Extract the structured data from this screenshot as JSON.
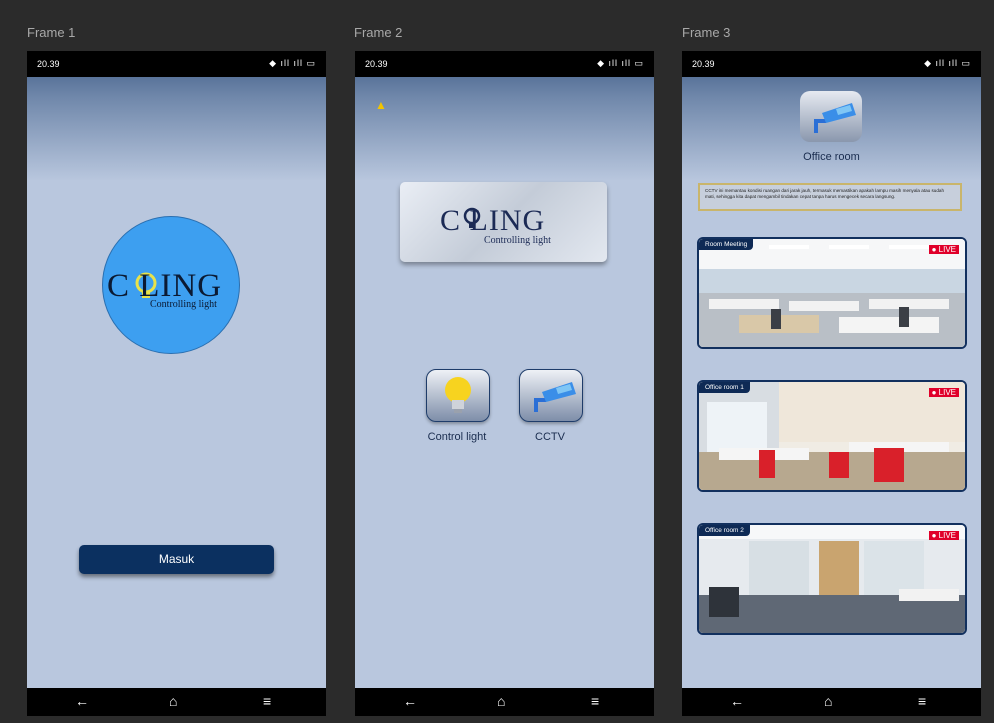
{
  "frames": [
    {
      "label": "Frame 1"
    },
    {
      "label": "Frame 2"
    },
    {
      "label": "Frame 3"
    }
  ],
  "status_bar": {
    "time": "20.39"
  },
  "frame1": {
    "logo_text": "C LING",
    "logo_sub": "Controlling light",
    "masuk_label": "Masuk"
  },
  "frame2": {
    "logo_text": "C LING",
    "logo_sub": "Controlling light",
    "control_light_label": "Control light",
    "cctv_label": "CCTV"
  },
  "frame3": {
    "title": "Office room",
    "notice": "CCTV ini memantau kondisi ruangan dari jarak jauh, termasuk memastikan apakah lampu masih menyala atau sudah mati, sehingga kita dapat mengambil tindakan cepat tanpa harus mengecek secara langsung.",
    "live_label": "LIVE",
    "cameras": [
      {
        "name": "Room Meeting"
      },
      {
        "name": "Office room 1"
      },
      {
        "name": "Office room 2"
      }
    ]
  }
}
